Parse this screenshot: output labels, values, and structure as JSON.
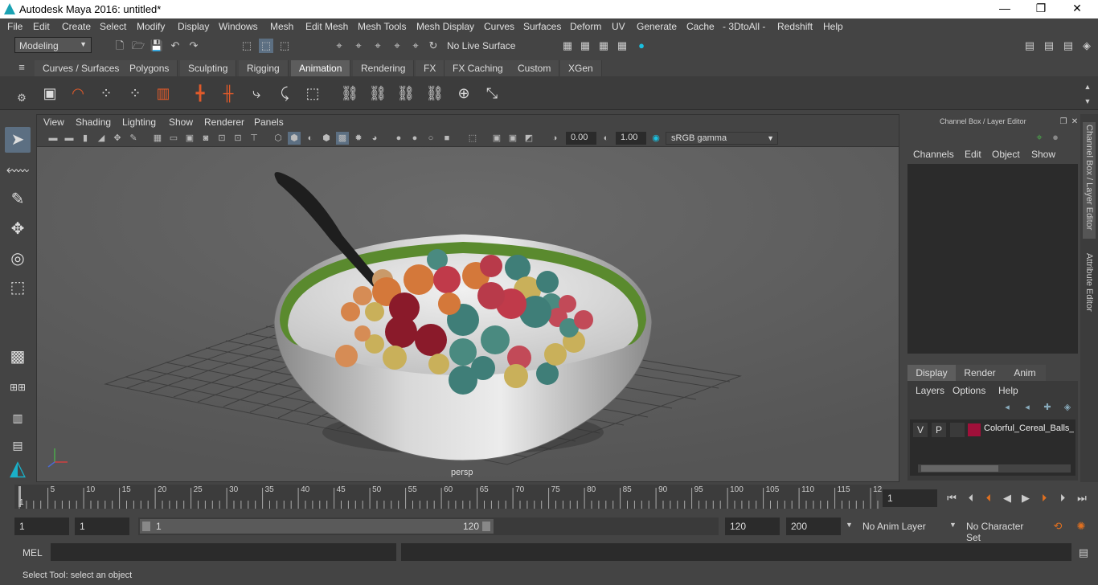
{
  "window": {
    "title": "Autodesk Maya 2016: untitled*",
    "minimize": "—",
    "maximize": "❐",
    "close": "✕"
  },
  "menubar": [
    "File",
    "Edit",
    "Create",
    "Select",
    "Modify",
    "Display",
    "Windows",
    "Mesh",
    "Edit Mesh",
    "Mesh Tools",
    "Mesh Display",
    "Curves",
    "Surfaces",
    "Deform",
    "UV",
    "Generate",
    "Cache",
    "- 3DtoAll -",
    "Redshift",
    "Help"
  ],
  "statusline": {
    "mode": "Modeling",
    "live_surface": "No Live Surface"
  },
  "shelf_tabs": [
    "Curves / Surfaces",
    "Polygons",
    "Sculpting",
    "Rigging",
    "Animation",
    "Rendering",
    "FX",
    "FX Caching",
    "Custom",
    "XGen"
  ],
  "shelf_active": "Animation",
  "viewport": {
    "menu": [
      "View",
      "Shading",
      "Lighting",
      "Show",
      "Renderer",
      "Panels"
    ],
    "exposure": "0.00",
    "gamma": "1.00",
    "color_space": "sRGB gamma",
    "camera_label": "persp"
  },
  "channelbox": {
    "title": "Channel Box / Layer Editor",
    "menu": [
      "Channels",
      "Edit",
      "Object",
      "Show"
    ],
    "layer_tabs": [
      "Display",
      "Render",
      "Anim"
    ],
    "layer_menu": [
      "Layers",
      "Options",
      "Help"
    ],
    "layer": {
      "v": "V",
      "p": "P",
      "name": "Colorful_Cereal_Balls_i",
      "color": "#a0103a"
    }
  },
  "side_tabs": {
    "channel": "Channel Box / Layer Editor",
    "attribute": "Attribute Editor"
  },
  "timeline": {
    "ticks": [
      "5",
      "10",
      "15",
      "20",
      "25",
      "30",
      "35",
      "40",
      "45",
      "50",
      "55",
      "60",
      "65",
      "70",
      "75",
      "80",
      "85",
      "90",
      "95",
      "100",
      "105",
      "110",
      "115",
      "12"
    ],
    "start_tick": "1",
    "current_frame": "1"
  },
  "range": {
    "start": "1",
    "playback_start": "1",
    "slider_start": "1",
    "slider_end": "120",
    "playback_end": "120",
    "end": "200",
    "anim_layer": "No Anim Layer",
    "character_set": "No Character Set"
  },
  "mel": {
    "label": "MEL"
  },
  "help_line": "Select Tool: select an object"
}
